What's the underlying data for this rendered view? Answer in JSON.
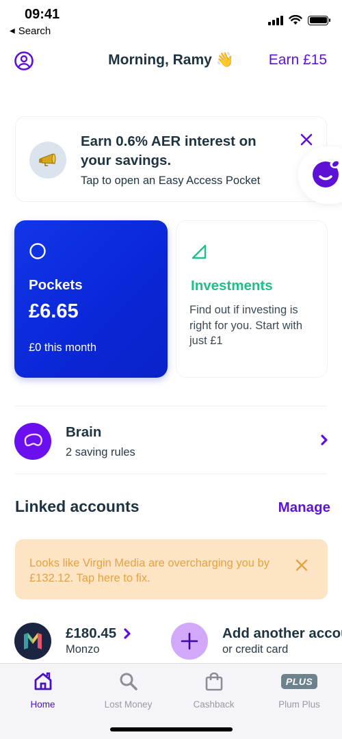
{
  "status_bar": {
    "time": "09:41",
    "back_label": "Search"
  },
  "header": {
    "greeting": "Morning, Ramy",
    "greeting_emoji": "👋",
    "earn_label": "Earn £15",
    "profile_icon": "user-circle-icon"
  },
  "promo": {
    "icon": "megaphone-icon",
    "title": "Earn 0.6% AER interest on your savings.",
    "subtitle": "Tap to open an Easy Access Pocket",
    "close_icon": "close-icon"
  },
  "chat_button": {
    "icon": "plum-chat-icon"
  },
  "tiles": {
    "pockets": {
      "icon": "circle-icon",
      "title": "Pockets",
      "amount": "£6.65",
      "subtitle": "£0 this month"
    },
    "investments": {
      "icon": "triangle-icon",
      "title": "Investments",
      "description": "Find out if investing is right for you. Start with just £1"
    }
  },
  "brain": {
    "icon": "brain-icon",
    "title": "Brain",
    "subtitle": "2 saving rules"
  },
  "linked_accounts": {
    "title": "Linked accounts",
    "manage_label": "Manage",
    "alert": {
      "text": "Looks like Virgin Media are overcharging you by £132.12. Tap here to fix."
    },
    "accounts": [
      {
        "name": "Monzo",
        "balance": "£180.45",
        "logo": "monzo-logo"
      }
    ],
    "add": {
      "title": "Add another account",
      "subtitle": "or credit card"
    }
  },
  "tabbar": {
    "tabs": [
      {
        "label": "Home",
        "icon": "home-icon",
        "active": true
      },
      {
        "label": "Lost Money",
        "icon": "search-icon",
        "active": false
      },
      {
        "label": "Cashback",
        "icon": "shopping-bag-icon",
        "active": false
      },
      {
        "label": "Plum Plus",
        "icon": "plus-badge-icon",
        "badge": "PLUS",
        "active": false
      }
    ]
  },
  "colors": {
    "brand_purple": "#5d10d6",
    "pockets_blue": "#0a27d6",
    "investments_green": "#1fbf85",
    "alert_bg": "#fde4c5",
    "alert_text": "#e6a23f",
    "text_dark": "#1d3340"
  }
}
